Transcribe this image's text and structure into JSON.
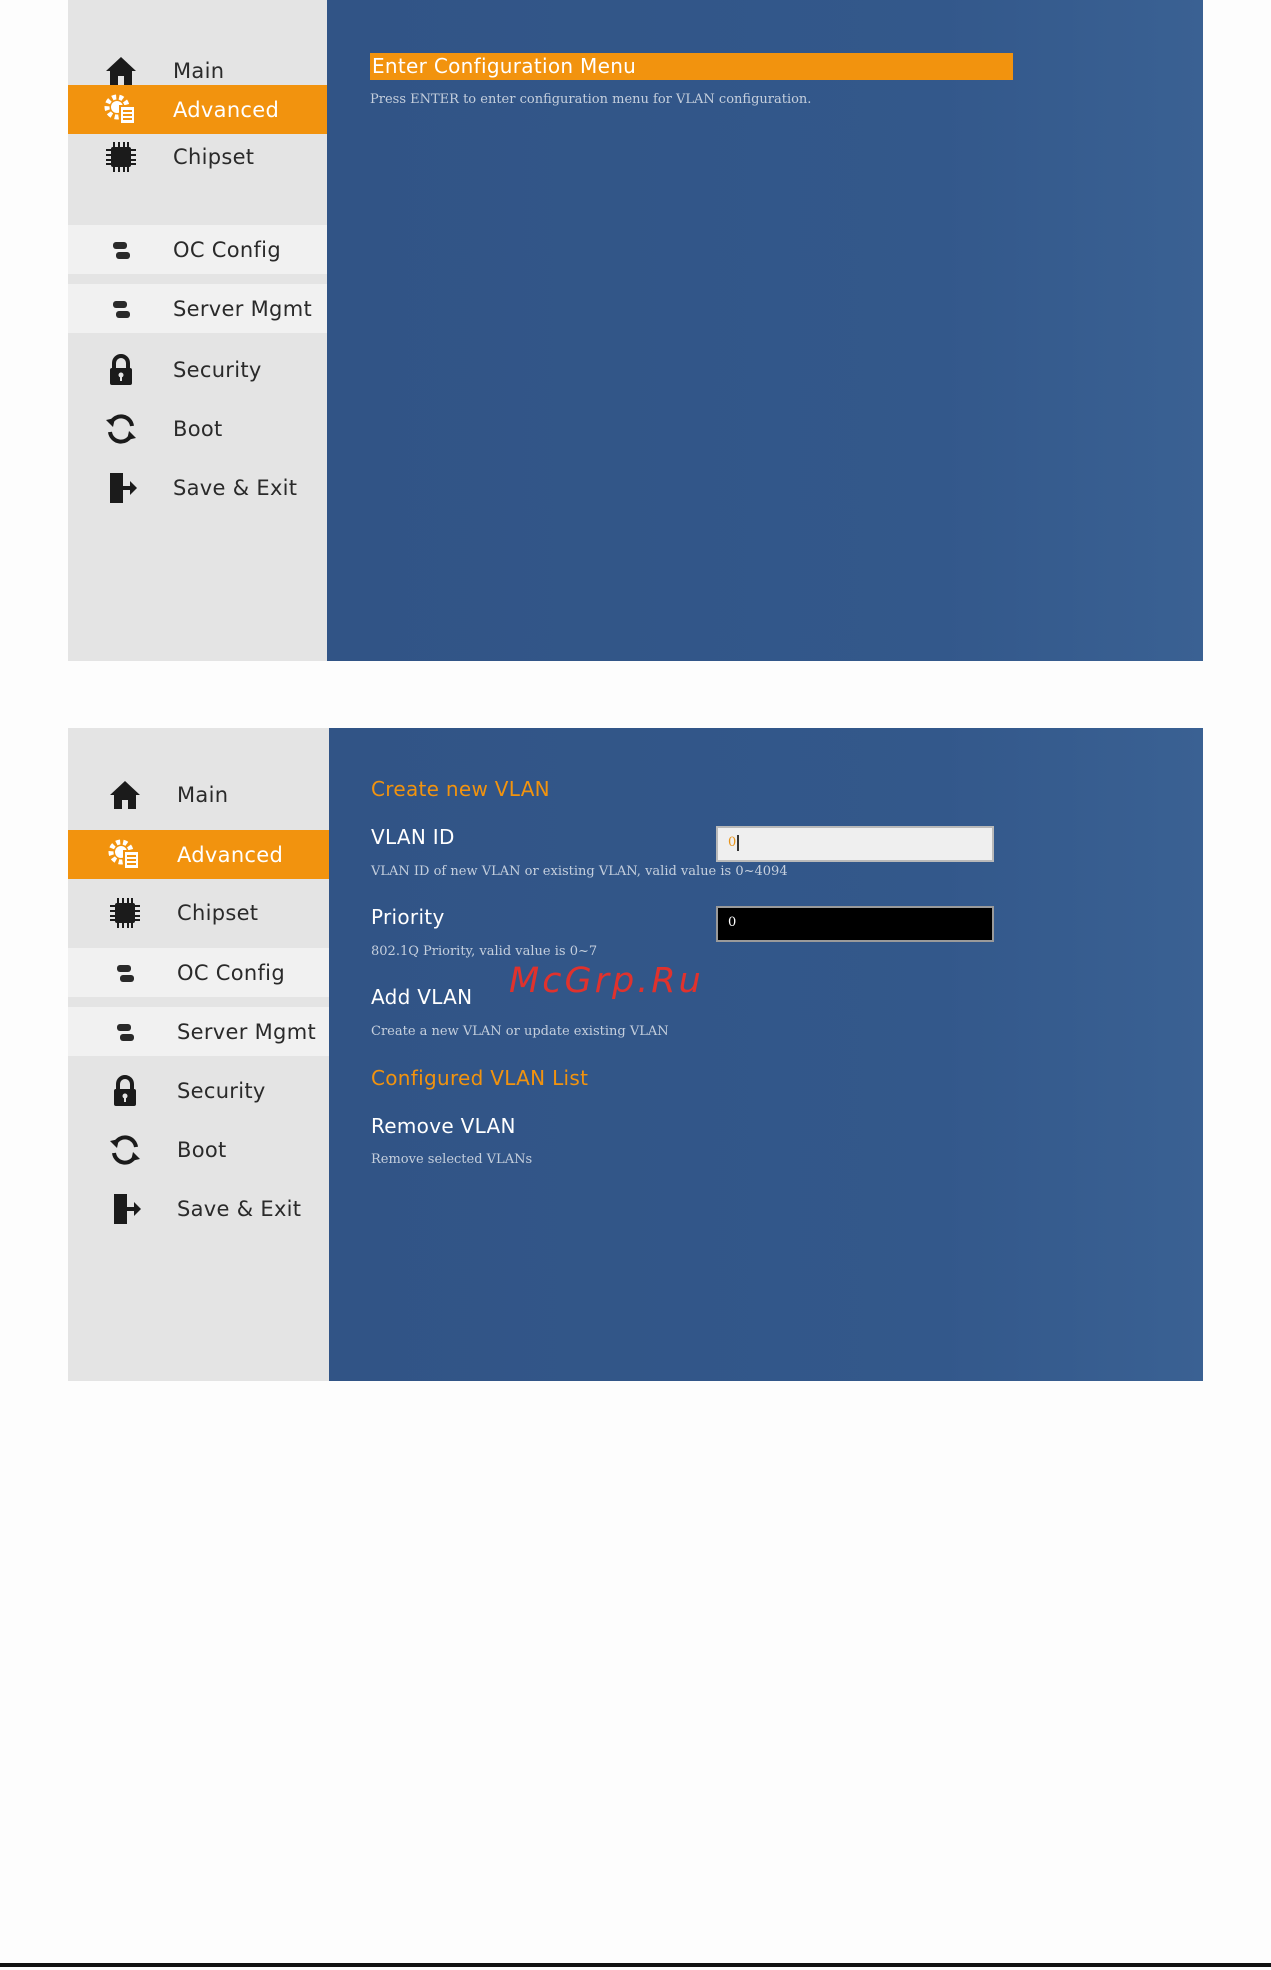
{
  "sidebar": {
    "items": [
      {
        "label": "Main",
        "icon": "home-icon"
      },
      {
        "label": "Advanced",
        "icon": "gear-list-icon"
      },
      {
        "label": "Chipset",
        "icon": "chip-icon"
      },
      {
        "label": "OC Config",
        "icon": "toggle-icon"
      },
      {
        "label": "Server Mgmt",
        "icon": "toggle-icon"
      },
      {
        "label": "Security",
        "icon": "lock-icon"
      },
      {
        "label": "Boot",
        "icon": "refresh-icon"
      },
      {
        "label": "Save & Exit",
        "icon": "exit-icon"
      }
    ],
    "active_item": "Advanced"
  },
  "screen1": {
    "selected_item": "Enter Configuration Menu",
    "help": "Press ENTER to enter configuration menu for VLAN configuration."
  },
  "screen2": {
    "create_title": "Create new VLAN",
    "vlan_id": {
      "label": "VLAN ID",
      "value": "0",
      "help": "VLAN ID of new VLAN or existing VLAN, valid value is 0~4094"
    },
    "priority": {
      "label": "Priority",
      "value": "0",
      "help": "802.1Q Priority, valid value is 0~7"
    },
    "add_vlan": {
      "label": "Add VLAN",
      "help": "Create a new VLAN or update existing VLAN"
    },
    "list_title": "Configured VLAN List",
    "remove_vlan": {
      "label": "Remove VLAN",
      "help": "Remove selected VLANs"
    }
  },
  "watermark": "McGrp.Ru",
  "colors": {
    "accent": "#f2930e",
    "panel_blue": "#33588b",
    "sidebar_gray": "#e4e4e4"
  }
}
